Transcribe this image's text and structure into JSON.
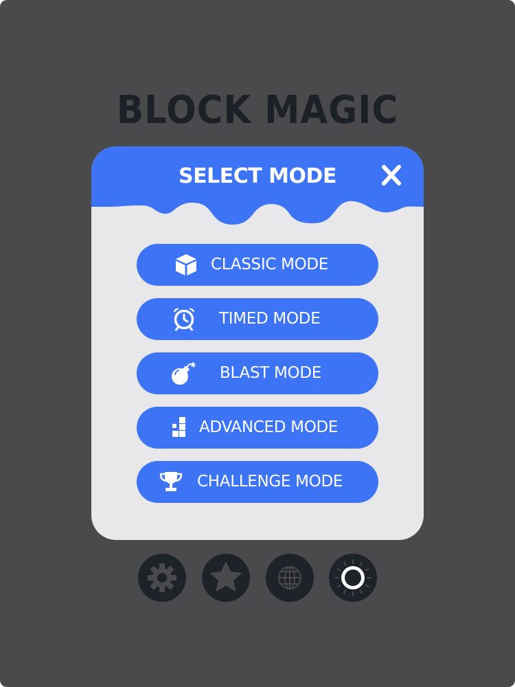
{
  "game": {
    "title": "BLOCK MAGIC"
  },
  "dialog": {
    "title": "SELECT MODE",
    "close_icon": "close-icon"
  },
  "modes": [
    {
      "label": "CLASSIC MODE",
      "icon": "cube-icon"
    },
    {
      "label": "TIMED MODE",
      "icon": "alarm-clock-icon"
    },
    {
      "label": "BLAST MODE",
      "icon": "bomb-icon"
    },
    {
      "label": "ADVANCED MODE",
      "icon": "blocks-icon"
    },
    {
      "label": "CHALLENGE MODE",
      "icon": "trophy-icon"
    }
  ],
  "bottom_bar": [
    {
      "icon": "gear-icon"
    },
    {
      "icon": "star-icon"
    },
    {
      "icon": "globe-icon"
    },
    {
      "icon": "theme-toggle-icon"
    }
  ],
  "colors": {
    "background": "#4a494b",
    "panel": "#e8e8ea",
    "accent": "#3d73f5",
    "dark": "#1e232a",
    "text_light": "#ffffff"
  }
}
